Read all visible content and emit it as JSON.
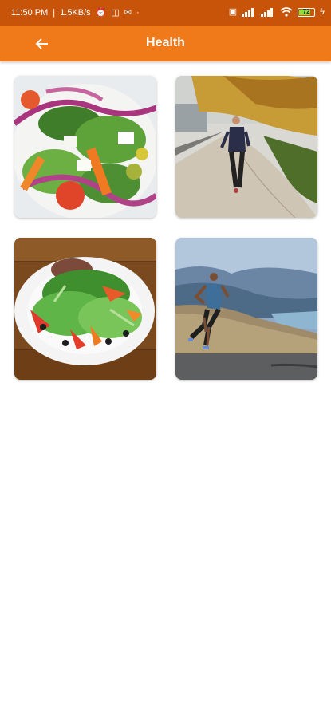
{
  "status_bar": {
    "time": "11:50 PM",
    "speed": "1.5KB/s",
    "battery": "72"
  },
  "app_bar": {
    "title": "Health",
    "back_icon": "arrow-left-icon"
  },
  "tiles": [
    {
      "name": "salad-image"
    },
    {
      "name": "jogging-woman-image"
    },
    {
      "name": "salad-plate-image"
    },
    {
      "name": "runner-man-image"
    }
  ],
  "colors": {
    "status_bar": "#c8540a",
    "app_bar": "#f07a1a"
  }
}
